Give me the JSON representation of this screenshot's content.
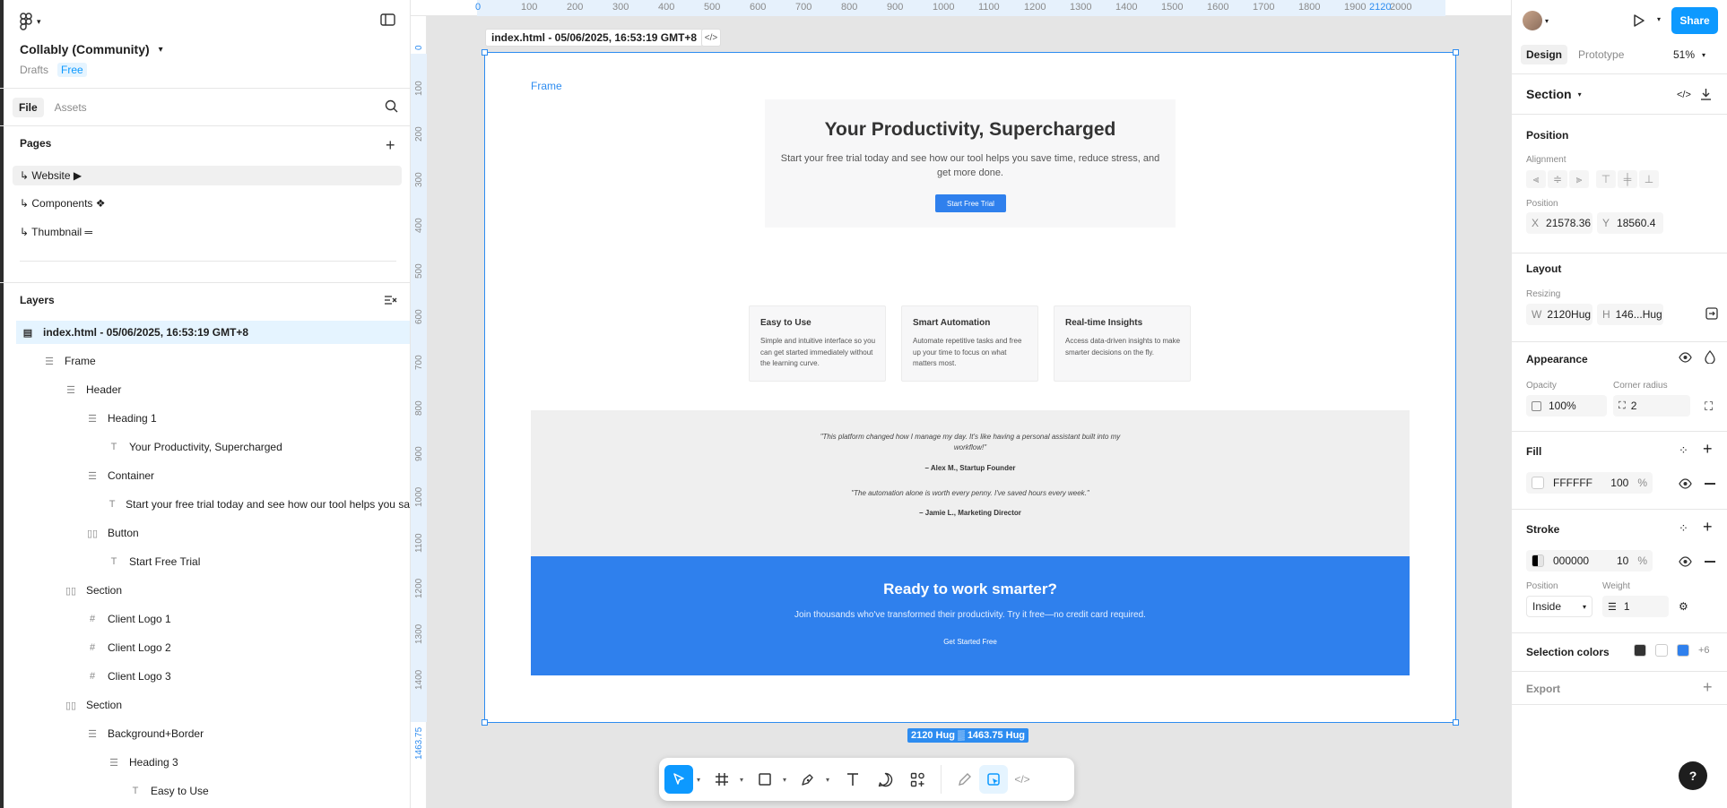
{
  "left": {
    "file_title": "Collably (Community)",
    "drafts": "Drafts",
    "plan": "Free",
    "tabs": {
      "file": "File",
      "assets": "Assets"
    },
    "pages_heading": "Pages",
    "pages": [
      "↳ Website ▶",
      "↳ Components ❖",
      "↳ Thumbnail ═"
    ],
    "layers_heading": "Layers",
    "layers": [
      {
        "label": "index.html - 05/06/2025, 16:53:19 GMT+8",
        "icon": "frame-icon"
      },
      {
        "label": "Frame",
        "icon": "auto-layout-icon"
      },
      {
        "label": "Header",
        "icon": "auto-layout-icon"
      },
      {
        "label": "Heading 1",
        "icon": "auto-layout-icon"
      },
      {
        "label": "Your Productivity, Supercharged",
        "icon": "text-icon"
      },
      {
        "label": "Container",
        "icon": "auto-layout-icon"
      },
      {
        "label": "Start your free trial today and see how our tool helps you sa",
        "icon": "text-icon"
      },
      {
        "label": "Button",
        "icon": "auto-layout-h-icon"
      },
      {
        "label": "Start Free Trial",
        "icon": "text-icon"
      },
      {
        "label": "Section",
        "icon": "auto-layout-h-icon"
      },
      {
        "label": "Client Logo 1",
        "icon": "hash-icon"
      },
      {
        "label": "Client Logo 2",
        "icon": "hash-icon"
      },
      {
        "label": "Client Logo 3",
        "icon": "hash-icon"
      },
      {
        "label": "Section",
        "icon": "auto-layout-h-icon"
      },
      {
        "label": "Background+Border",
        "icon": "auto-layout-icon"
      },
      {
        "label": "Heading 3",
        "icon": "auto-layout-icon"
      },
      {
        "label": "Easy to Use",
        "icon": "text-icon"
      }
    ]
  },
  "ruler": {
    "top": [
      "0",
      "100",
      "200",
      "300",
      "400",
      "500",
      "600",
      "700",
      "800",
      "900",
      "1000",
      "1100",
      "1200",
      "1300",
      "1400",
      "1500",
      "1600",
      "1700",
      "1800",
      "1900",
      "2000",
      "2120"
    ],
    "left": [
      "0",
      "100",
      "200",
      "300",
      "400",
      "500",
      "600",
      "700",
      "800",
      "900",
      "1000",
      "1100",
      "1200",
      "1300",
      "1400",
      "1463.75"
    ]
  },
  "canvas": {
    "frame_label": "index.html - 05/06/2025, 16:53:19 GMT+8",
    "code_glyph": "</>",
    "size_badge": "2120 Hug ▒ 1463.75 Hug",
    "page": {
      "frame_tag": "Frame",
      "hero": {
        "title": "Your Productivity, Supercharged",
        "body": "Start your free trial today and see how our tool helps you save time, reduce stress, and get more done.",
        "button": "Start Free Trial"
      },
      "features": [
        {
          "title": "Easy to Use",
          "body": "Simple and intuitive interface so you can get started immediately without the learning curve."
        },
        {
          "title": "Smart Automation",
          "body": "Automate repetitive tasks and free up your time to focus on what matters most."
        },
        {
          "title": "Real-time Insights",
          "body": "Access data-driven insights to make smarter decisions on the fly."
        }
      ],
      "testimonials": [
        {
          "quote": "\"This platform changed how I manage my day. It's like having a personal assistant built into my workflow!\"",
          "author": "– Alex M., Startup Founder"
        },
        {
          "quote": "\"The automation alone is worth every penny. I've saved hours every week.\"",
          "author": "– Jamie L., Marketing Director"
        }
      ],
      "cta": {
        "title": "Ready to work smarter?",
        "body": "Join thousands who've transformed their productivity. Try it free—no credit card required.",
        "button": "Get Started Free"
      }
    }
  },
  "right": {
    "share": "Share",
    "tabs": {
      "design": "Design",
      "prototype": "Prototype"
    },
    "zoom": "51%",
    "selection_name": "Section",
    "position": {
      "title": "Position",
      "alignment_label": "Alignment",
      "position_label": "Position",
      "x_label": "X",
      "x": "21578.36",
      "y_label": "Y",
      "y": "18560.4"
    },
    "layout": {
      "title": "Layout",
      "resizing_label": "Resizing",
      "w_label": "W",
      "w": "2120",
      "w_mode": "Hug",
      "h_label": "H",
      "h": "146...",
      "h_mode": "Hug"
    },
    "appearance": {
      "title": "Appearance",
      "opacity_label": "Opacity",
      "opacity": "100%",
      "radius_label": "Corner radius",
      "radius": "2"
    },
    "fill": {
      "title": "Fill",
      "hex": "FFFFFF",
      "opacity": "100",
      "pct": "%",
      "color": "#ffffff"
    },
    "stroke": {
      "title": "Stroke",
      "hex": "000000",
      "opacity": "10",
      "pct": "%",
      "position_label": "Position",
      "position": "Inside",
      "weight_label": "Weight",
      "weight": "1"
    },
    "selection_colors": {
      "title": "Selection colors",
      "more": "+6",
      "colors": [
        "#333333",
        "#ffffff",
        "#2f80ed"
      ]
    },
    "export": {
      "title": "Export"
    }
  },
  "colors": {
    "accent": "#0d99ff",
    "brand_blue": "#2f80ed",
    "selection": "#2d8cf0"
  }
}
